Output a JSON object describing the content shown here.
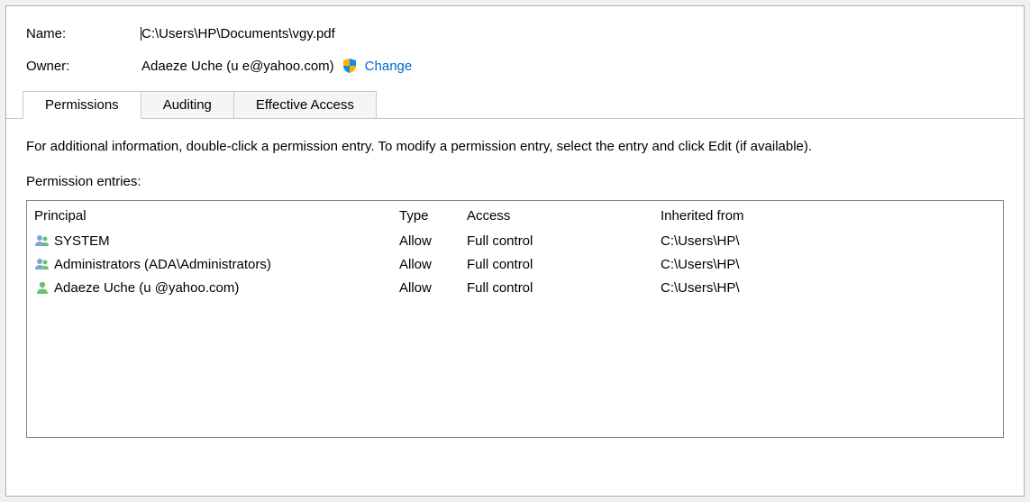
{
  "header": {
    "name_label": "Name:",
    "name_value": "C:\\Users\\HP\\Documents\\vgy.pdf",
    "owner_label": "Owner:",
    "owner_value": "Adaeze Uche (u                 e@yahoo.com)",
    "change_label": "Change"
  },
  "tabs": {
    "permissions": "Permissions",
    "auditing": "Auditing",
    "effective_access": "Effective Access"
  },
  "content": {
    "help_text": "For additional information, double-click a permission entry. To modify a permission entry, select the entry and click Edit (if available).",
    "entries_label": "Permission entries:",
    "columns": {
      "principal": "Principal",
      "type": "Type",
      "access": "Access",
      "inherited": "Inherited from"
    },
    "rows": [
      {
        "icon": "group",
        "principal": "SYSTEM",
        "type": "Allow",
        "access": "Full control",
        "inherited": "C:\\Users\\HP\\"
      },
      {
        "icon": "group",
        "principal": "Administrators (ADA\\Administrators)",
        "type": "Allow",
        "access": "Full control",
        "inherited": "C:\\Users\\HP\\"
      },
      {
        "icon": "user",
        "principal": "Adaeze Uche (u             @yahoo.com)",
        "type": "Allow",
        "access": "Full control",
        "inherited": "C:\\Users\\HP\\"
      }
    ]
  }
}
